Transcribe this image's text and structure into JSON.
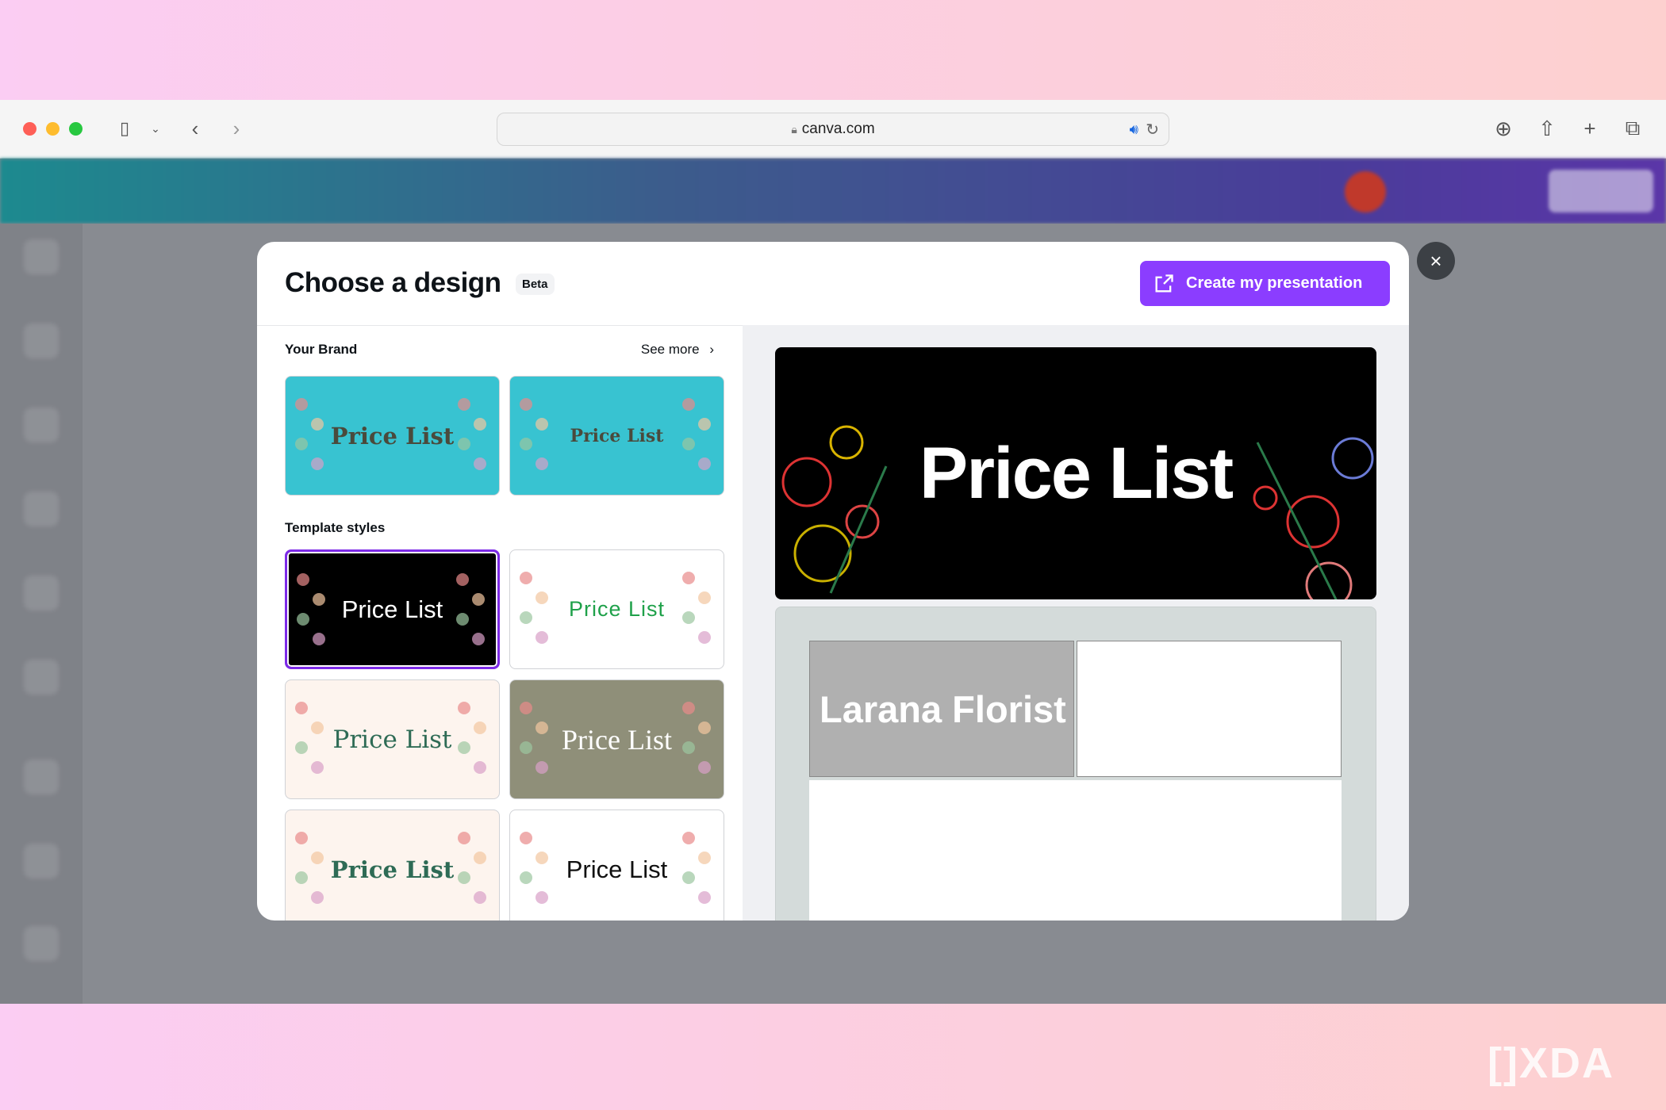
{
  "browser": {
    "url": "canva.com"
  },
  "modal": {
    "title": "Choose a design",
    "badge": "Beta",
    "create_button": "Create my presentation",
    "your_brand": {
      "label": "Your Brand",
      "see_more": "See more",
      "items": [
        {
          "text": "Price List"
        },
        {
          "text": "Price List"
        }
      ]
    },
    "template_styles": {
      "label": "Template styles",
      "items": [
        {
          "text": "Price List",
          "selected": true
        },
        {
          "text": "Price List"
        },
        {
          "text": "Price List"
        },
        {
          "text": "Price List"
        },
        {
          "text": "Price List"
        },
        {
          "text": "Price List"
        }
      ]
    },
    "preview": {
      "slide1_title": "Price List",
      "slide2_title": "Larana Florist"
    }
  },
  "colors": {
    "accent": "#8b3dff",
    "brand_card": "#38c3d1"
  },
  "watermark": "XDA"
}
